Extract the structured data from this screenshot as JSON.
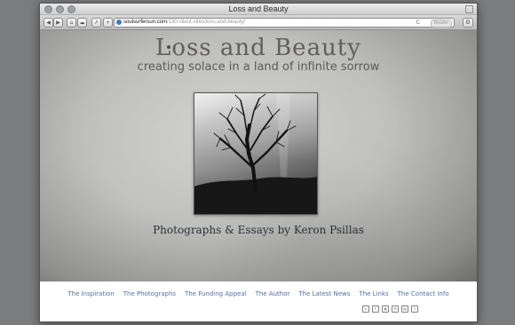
{
  "window": {
    "title": "Loss and Beauty"
  },
  "toolbar": {
    "url_domain": "soulsurfersun.com",
    "url_path": "/130-client-sites/loss-and-beauty/",
    "reader_label": "Reader"
  },
  "site": {
    "title": "Loss and Beauty",
    "subtitle": "creating solace in a land of infinite sorrow",
    "byline": "Photographs & Essays by Keron Psillas"
  },
  "nav": {
    "items": [
      "The Inspiration",
      "The Photographs",
      "The Funding Appeal",
      "The Author",
      "The Latest News",
      "The Links",
      "The Contact Info"
    ]
  },
  "social": {
    "icons": [
      "rss-icon",
      "twitter-icon",
      "share-icon",
      "mail-icon",
      "print-icon",
      "download-icon"
    ]
  }
}
